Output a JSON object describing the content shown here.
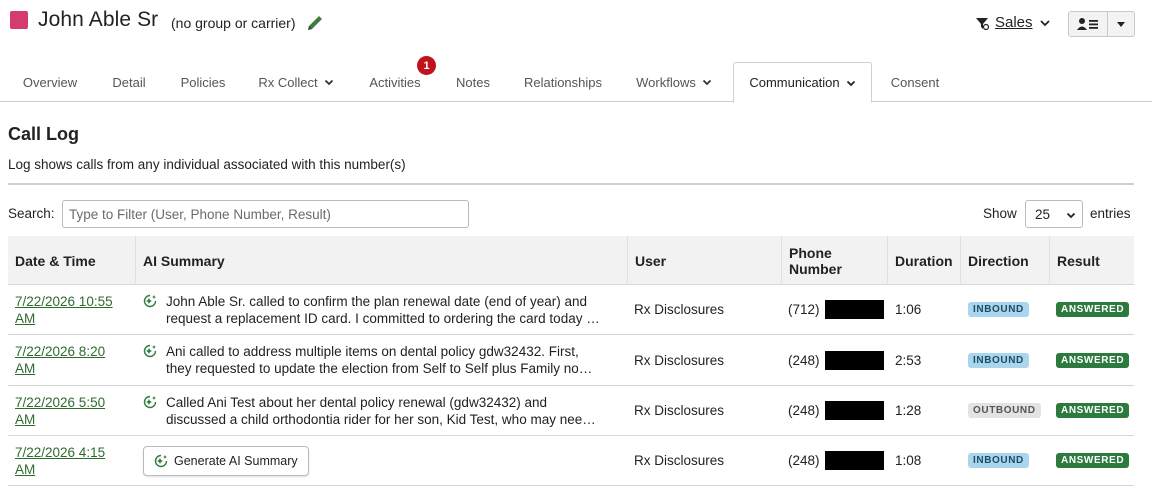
{
  "header": {
    "name": "John Able Sr",
    "group": "(no group or carrier)",
    "sales_label": "Sales",
    "color": "#d63b6f"
  },
  "tabs": [
    {
      "label": "Overview"
    },
    {
      "label": "Detail"
    },
    {
      "label": "Policies"
    },
    {
      "label": "Rx Collect",
      "dropdown": true
    },
    {
      "label": "Activities",
      "badge": "1"
    },
    {
      "label": "Notes"
    },
    {
      "label": "Relationships"
    },
    {
      "label": "Workflows",
      "dropdown": true
    },
    {
      "label": "Communication",
      "dropdown": true,
      "active": true
    },
    {
      "label": "Consent"
    }
  ],
  "call_log": {
    "title": "Call Log",
    "subtitle": "Log shows calls from any individual associated with this number(s)",
    "search_label": "Search:",
    "search_placeholder": "Type to Filter (User, Phone Number, Result)",
    "search_value": "",
    "show_label": "Show",
    "page_size": "25",
    "entries_label": "entries"
  },
  "table": {
    "columns": [
      "Date & Time",
      "AI Summary",
      "User",
      "Phone Number",
      "Duration",
      "Direction",
      "Result"
    ],
    "rows": [
      {
        "date_line1": "7/22/2026 10:55",
        "date_line2": "AM",
        "summary_line1": "John Able Sr. called to confirm the plan renewal date (end of year) and",
        "summary_line2": "request a replacement ID card. I committed to ordering the card today …",
        "user": "Rx Disclosures",
        "phone_prefix": "(712)",
        "duration": "1:06",
        "direction": "INBOUND",
        "result": "ANSWERED"
      },
      {
        "date_line1": "7/22/2026 8:20",
        "date_line2": "AM",
        "summary_line1": "Ani called to address multiple items on dental policy gdw32432. First,",
        "summary_line2": "they requested to update the election from Self to Self plus Family no…",
        "user": "Rx Disclosures",
        "phone_prefix": "(248)",
        "duration": "2:53",
        "direction": "INBOUND",
        "result": "ANSWERED"
      },
      {
        "date_line1": "7/22/2026 5:50",
        "date_line2": "AM",
        "summary_line1": "Called Ani Test about her dental policy renewal (gdw32432) and",
        "summary_line2": "discussed a child orthodontia rider for her son, Kid Test, who may nee…",
        "user": "Rx Disclosures",
        "phone_prefix": "(248)",
        "duration": "1:28",
        "direction": "OUTBOUND",
        "result": "ANSWERED"
      },
      {
        "date_line1": "7/22/2026 4:15",
        "date_line2": "AM",
        "generate_label": "Generate AI Summary",
        "user": "Rx Disclosures",
        "phone_prefix": "(248)",
        "duration": "1:08",
        "direction": "INBOUND",
        "result": "ANSWERED"
      }
    ]
  },
  "colors": {
    "accent_green": "#2f6b2f",
    "badge_red": "#c0141c",
    "inbound": "#a9d6ec",
    "outbound": "#e3e3e3",
    "answered": "#2c7a3d"
  }
}
